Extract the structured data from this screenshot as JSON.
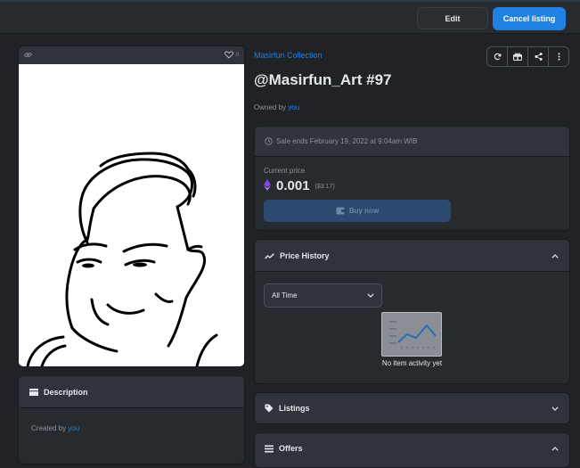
{
  "toolbar": {
    "edit_label": "Edit",
    "cancel_label": "Cancel listing"
  },
  "asset": {
    "likes": "0",
    "collection": "Masirfun Collection",
    "title": "@Masirfun_Art #97",
    "owned_by_prefix": "Owned by",
    "owner": "you"
  },
  "description": {
    "heading": "Description",
    "created_by_prefix": "Created by",
    "creator": "you"
  },
  "sale": {
    "ends_text": "Sale ends February 19, 2022 at 9:04am WIB",
    "current_price_label": "Current price",
    "price": "0.001",
    "usd": "($3.17)",
    "buy_label": "Buy now"
  },
  "price_history": {
    "heading": "Price History",
    "range_selected": "All Time",
    "empty_text": "No item activity yet"
  },
  "listings": {
    "heading": "Listings"
  },
  "offers": {
    "heading": "Offers"
  },
  "colors": {
    "accent": "#2081e2",
    "background": "#202225",
    "card": "#303339",
    "panel": "#262b2f",
    "eth": "#8247e5"
  }
}
